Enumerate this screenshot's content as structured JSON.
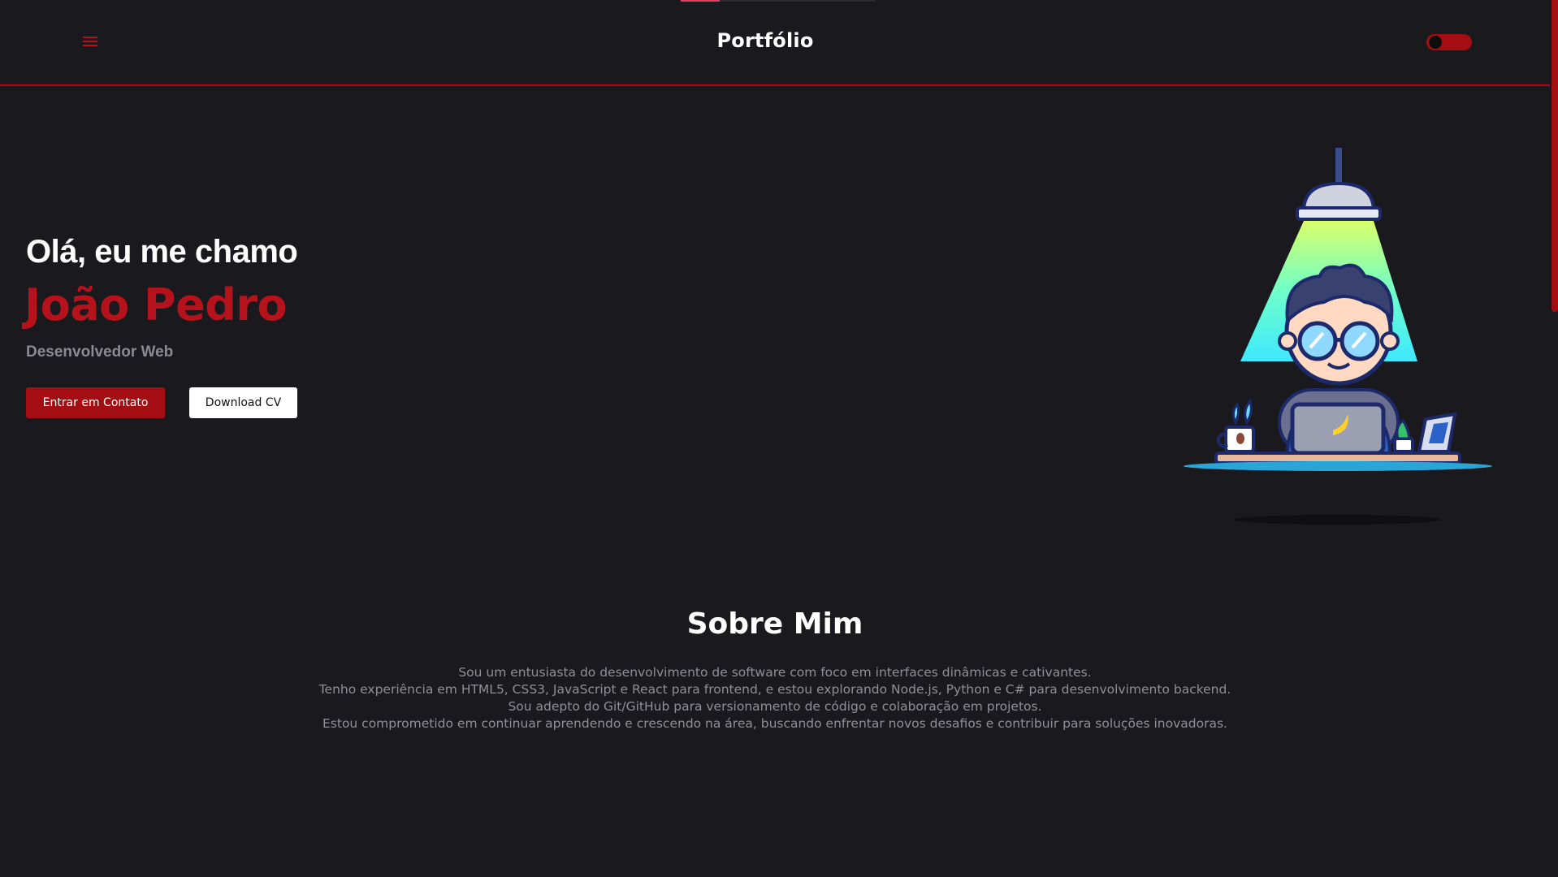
{
  "header": {
    "brand": "Portfólio",
    "menu_icon": "hamburger-menu-icon",
    "theme_toggle_icon": "theme-toggle"
  },
  "hero": {
    "greeting": "Olá, eu me chamo",
    "name": "João Pedro",
    "role": "Desenvolvedor Web",
    "contact_button": "Entrar em Contato",
    "cv_button": "Download CV",
    "illustration": "developer-at-laptop-under-lamp-illustration"
  },
  "about": {
    "title": "Sobre Mim",
    "lines": [
      "Sou um entusiasta do desenvolvimento de software com foco em interfaces dinâmicas e cativantes.",
      "Tenho experiência em HTML5, CSS3, JavaScript e React para frontend, e estou explorando Node.js, Python e C# para desenvolvimento backend.",
      "Sou adepto do Git/GitHub para versionamento de código e colaboração em projetos.",
      "Estou comprometido em continuar aprendendo e crescendo na área, buscando enfrentar novos desafios e contribuir para soluções inovadoras."
    ]
  },
  "colors": {
    "accent": "#a40e12",
    "background": "#1a1a1e",
    "text": "#ffffff",
    "muted": "#8f8f96"
  }
}
